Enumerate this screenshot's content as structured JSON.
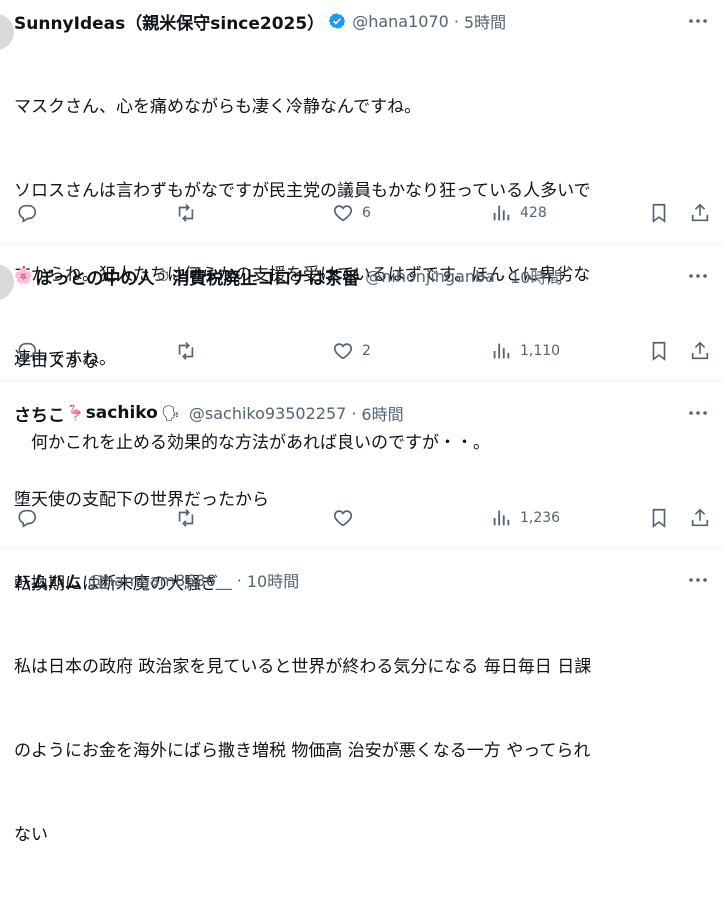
{
  "tweets": [
    {
      "name": "SunnyIdeas（親米保守since2025）",
      "handle": "@hana1070",
      "dot": "·",
      "time": "5時間",
      "verified": true,
      "lines": [
        "マスクさん、心を痛めながらも凄く冷静なんですね。",
        "ソロスさんは言わずもがなですが民主党の議員もかなり狂っている人多いで",
        "すからね。犯人たちは何らかの支援を受けているはずです。ほんとに卑劣な",
        "連中ですね。",
        "　何かこれを止める効果的な方法があれば良いのですが・・。"
      ],
      "likes": "6",
      "views": "428"
    },
    {
      "name_prefix_emoji": "🌸",
      "name": "ぼっとの中の人",
      "name_mid_emoji": "⏱",
      "name_suffix": "消費税廃止コロナは茶番",
      "handle": "@nihonjinganba",
      "dot": "·",
      "time": "10時間",
      "lines": [
        "ソロスかな"
      ],
      "likes": "2",
      "views": "1,110"
    },
    {
      "name": "さちこ",
      "name_mid_emoji": "🦩",
      "name_suffix": "sachiko",
      "name_end_emoji": "🗣",
      "handle": "@sachiko93502257",
      "dot": "·",
      "time": "6時間",
      "lines": [
        "堕天使の支配下の世界だったから",
        "転換期には断末魔の大騒ぎ"
      ],
      "likes": "",
      "views": "1,236"
    },
    {
      "name": "ハムハム",
      "handle": "@hamham8686__",
      "dot": "·",
      "time": "10時間",
      "lines": [
        "私は日本の政府 政治家を見ていると世界が終わる気分になる 毎日毎日 日課",
        "のようにお金を海外にばら撒き増税 物価高 治安が悪くなる一方 やってられ",
        "ない"
      ]
    }
  ],
  "icons": {
    "reply": "reply-icon",
    "retweet": "retweet-icon",
    "like": "heart-icon",
    "views": "views-icon",
    "bookmark": "bookmark-icon",
    "share": "share-icon",
    "more": "more-icon"
  },
  "colors": {
    "text": "#0f1419",
    "secondary": "#536471",
    "divider": "#eff3f4",
    "verified": "#1d9bf0"
  }
}
